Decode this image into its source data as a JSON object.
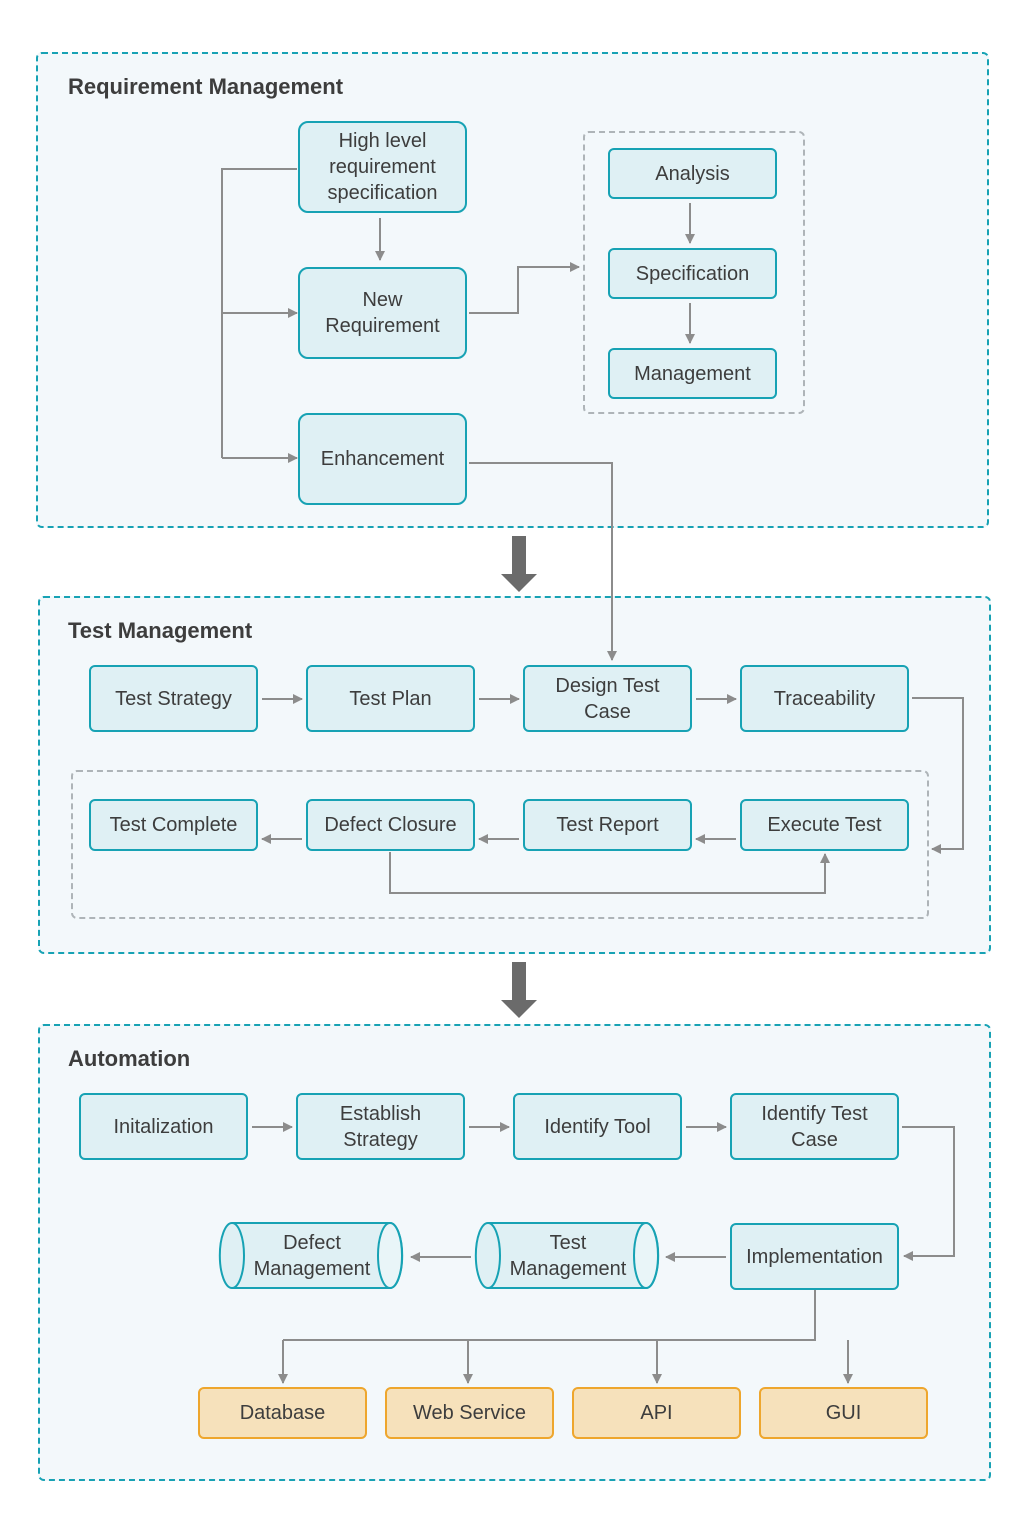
{
  "sections": {
    "requirement": {
      "title": "Requirement Management",
      "nodes": {
        "high_level": "High level requirement specification",
        "new_requirement": "New Requirement",
        "enhancement": "Enhancement",
        "analysis": "Analysis",
        "specification": "Specification",
        "management": "Management"
      }
    },
    "test": {
      "title": "Test Management",
      "nodes": {
        "test_strategy": "Test Strategy",
        "test_plan": "Test Plan",
        "design_test_case": "Design Test Case",
        "traceability": "Traceability",
        "execute_test": "Execute Test",
        "test_report": "Test Report",
        "defect_closure": "Defect Closure",
        "test_complete": "Test Complete"
      }
    },
    "automation": {
      "title": "Automation",
      "nodes": {
        "initialization": "Initalization",
        "establish_strategy": "Establish Strategy",
        "identify_tool": "Identify Tool",
        "identify_test_case": "Identify Test Case",
        "implementation": "Implementation",
        "test_management": "Test Management",
        "defect_management": "Defect Management",
        "database": "Database",
        "web_service": "Web Service",
        "api": "API",
        "gui": "GUI"
      }
    }
  },
  "colors": {
    "section_border": "#17a2b4",
    "node_fill": "#dff0f4",
    "node_border": "#17a2b4",
    "target_fill": "#f6e1bb",
    "target_border": "#eea62d",
    "connector": "#8c8c8c",
    "flow_arrow": "#6b6b6b"
  }
}
